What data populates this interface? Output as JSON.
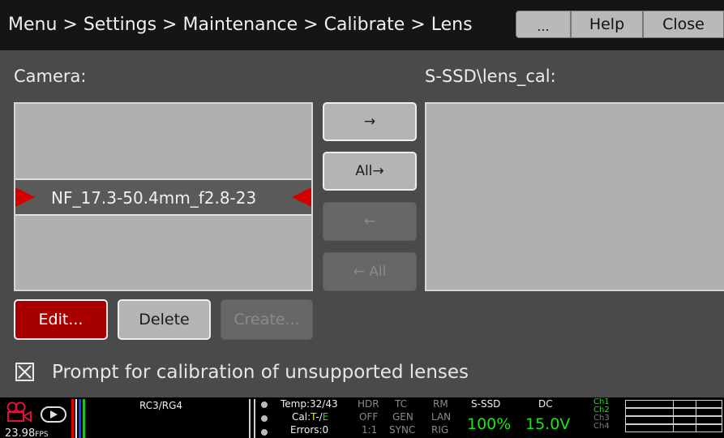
{
  "title_bar": {
    "breadcrumb": "Menu > Settings > Maintenance > Calibrate > Lens",
    "more_label": "...",
    "help_label": "Help",
    "close_label": "Close"
  },
  "source": {
    "label": "Camera:",
    "selected_item": "NF_17.3-50.4mm_f2.8-23"
  },
  "destination": {
    "label": "S-SSD\\lens_cal:"
  },
  "transfer_buttons": {
    "copy_right": "→",
    "copy_all_right_text": "All",
    "copy_all_right_arrow": "→",
    "copy_left": "←",
    "copy_all_left_arrow": "←",
    "copy_all_left_text": "All"
  },
  "actions": {
    "edit": "Edit...",
    "delete": "Delete",
    "create": "Create..."
  },
  "prompt_checkbox": {
    "checked": true,
    "label": "Prompt for calibration of unsupported lenses"
  },
  "status_bar": {
    "fps": "23.98",
    "fps_unit": "FPS",
    "look": "RC3/RG4",
    "temp": "Temp:32/43",
    "cal_prefix": "Cal:",
    "cal_t": "T",
    "cal_sep": "-/",
    "cal_e": "E",
    "errors": "Errors:0",
    "hdr": [
      "HDR",
      "OFF",
      "1:1"
    ],
    "tc": [
      "TC",
      "GEN",
      "SYNC"
    ],
    "rm": [
      "RM",
      "LAN",
      "RIG"
    ],
    "media_label": "S-SSD",
    "media_value": "100%",
    "power_label": "DC",
    "power_value": "15.0V",
    "channels": [
      "Ch1",
      "Ch2",
      "Ch3",
      "Ch4"
    ]
  },
  "colors": {
    "accent_red": "#d40000",
    "edit_button": "#a80000",
    "status_green": "#19e619"
  }
}
